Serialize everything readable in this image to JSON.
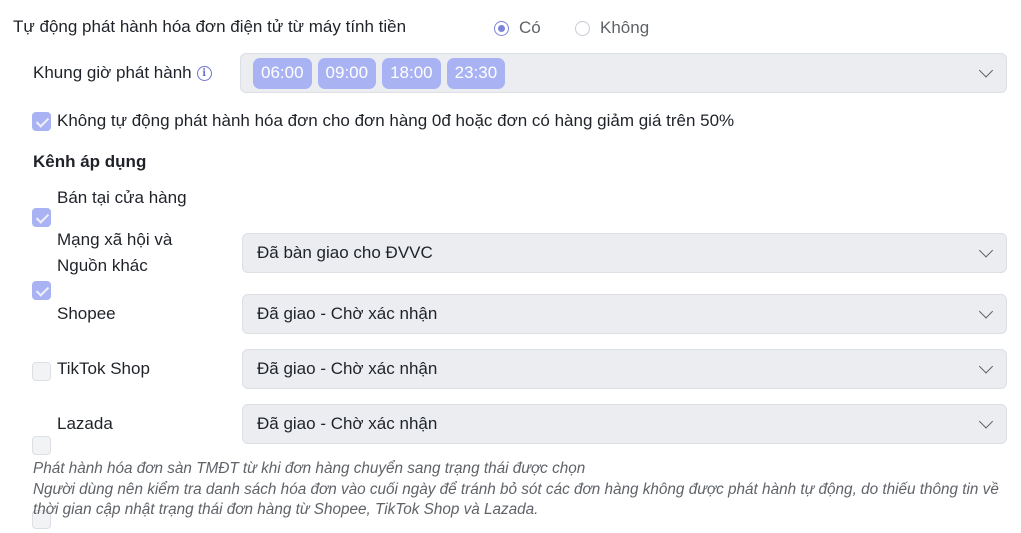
{
  "header": {
    "title": "Tự động phát hành hóa đơn điện tử từ máy tính tiền",
    "options": [
      {
        "label": "Có",
        "selected": true
      },
      {
        "label": "Không",
        "selected": false
      }
    ]
  },
  "schedule": {
    "label": "Khung giờ phát hành",
    "info_icon": "info-icon",
    "times": [
      "06:00",
      "09:00",
      "18:00",
      "23:30"
    ]
  },
  "skip_zero": {
    "checked": true,
    "label": "Không tự động phát hành hóa đơn cho đơn hàng 0đ hoặc đơn có hàng giảm giá trên 50%"
  },
  "channels": {
    "title": "Kênh áp dụng",
    "store": {
      "label": "Bán tại cửa hàng",
      "checked": true
    },
    "social": {
      "label_line1": "Mạng xã hội và",
      "label_line2": "Nguồn khác",
      "checked": true,
      "status": "Đã bàn giao cho ĐVVC"
    },
    "shopee": {
      "label": "Shopee",
      "checked": false,
      "status": "Đã giao - Chờ xác nhận"
    },
    "tiktok": {
      "label": "TikTok Shop",
      "checked": false,
      "status": "Đã giao - Chờ xác nhận"
    },
    "lazada": {
      "label": "Lazada",
      "checked": false,
      "status": "Đã giao - Chờ xác nhận"
    }
  },
  "note": {
    "line1": "Phát hành hóa đơn sàn TMĐT từ khi đơn hàng chuyển sang trạng thái được chọn",
    "line2": "Người dùng nên kiểm tra danh sách hóa đơn vào cuối ngày để tránh bỏ sót các đơn hàng không được phát hành tự động, do thiếu thông tin về thời gian cập nhật trạng thái đơn hàng từ Shopee, TikTok Shop và Lazada."
  },
  "colors": {
    "accent": "#a9b3f3",
    "radio_accent": "#7c84d6",
    "field_bg": "#ebedf0"
  }
}
